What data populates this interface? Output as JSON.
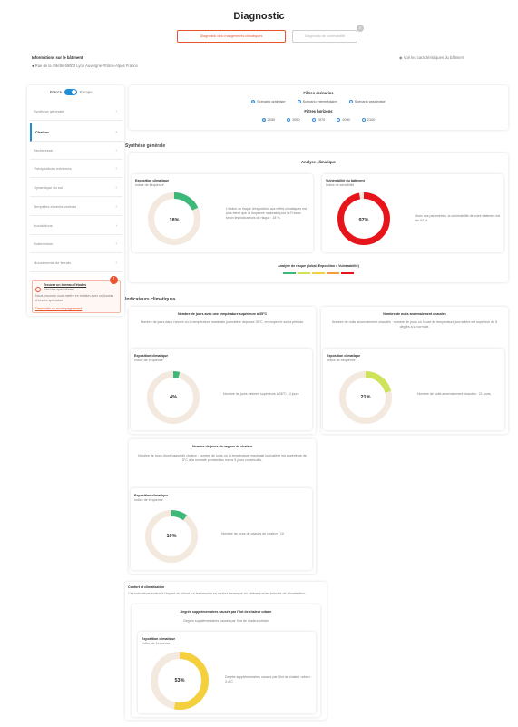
{
  "header": {
    "title": "Diagnostic",
    "step1": "Diagnostic des changements climatiques",
    "step2": "Diagnostic de vulnérabilité",
    "step2_badge": "2"
  },
  "building": {
    "info_label": "Informations sur le bâtiment",
    "address": "Rue de la Villette 69003 Lyon Auvergne-Rhône-Alpes France",
    "climate_link": "Voir les caractéristiques du bâtiment"
  },
  "sidebar": {
    "toggle_left": "France",
    "toggle_right": "Europe",
    "items": [
      {
        "label": "Synthèse générale"
      },
      {
        "label": "Chaleur"
      },
      {
        "label": "Sécheresse"
      },
      {
        "label": "Précipitations extrêmes"
      },
      {
        "label": "Dynamique du sol"
      },
      {
        "label": "Tempêtes et vents violents"
      },
      {
        "label": "Inondations"
      },
      {
        "label": "Submersion"
      },
      {
        "label": "Mouvements de terrain"
      }
    ],
    "promo": {
      "title": "Trouver un bureau d'études",
      "subtitle": "d'études spécialisées",
      "text": "Nous pouvons vous mettre en relation avec un bureau d'études spécialisé",
      "link": "Demander un accompagnement"
    }
  },
  "filters": {
    "scenarios_title": "Filtres scénarios",
    "scenarios": [
      "Scénario optimiste",
      "Scénario intermédiaire",
      "Scénario pessimiste"
    ],
    "horizons_title": "Filtres horizons",
    "horizons": [
      "2030",
      "2050",
      "2070",
      "2090",
      "2100"
    ]
  },
  "synthese": {
    "section_title": "Synthèse générale",
    "analysis_title": "Analyse climatique",
    "exposition": {
      "title": "Exposition climatique",
      "subtitle": "Indice de fréquence",
      "value": "18%",
      "fraction": 0.18,
      "description": "L'indice de risque d'exposition aux effets climatiques est plus élevé que la moyenne nationale pour la France, selon les indicateurs de risque : 18 %."
    },
    "vulnerabilite": {
      "title": "Vulnérabilité du bâtiment",
      "subtitle": "Indice de sensibilité",
      "value": "97%",
      "fraction": 0.97,
      "description": "Avec vos paramètres, la vulnérabilité de votre bâtiment est de 97 %."
    },
    "risk_legend": "Analyse de risque global (Exposition x Vulnérabilité)"
  },
  "indicateurs": {
    "section_title": "Indicateurs climatiques",
    "cards": [
      {
        "title": "Nombre de jours avec une température supérieure à 35°C",
        "desc": "Nombre de jours dans l'année où la température maximale journalière dépasse 35°C, en moyenne sur la période.",
        "exp_title": "Exposition climatique",
        "exp_sub": "Indice de fréquence",
        "value": "4%",
        "fraction": 0.04,
        "side": "Nombre de jours estimés supérieurs à 35°C : 4 jours"
      },
      {
        "title": "Nombre de nuits anormalement chaudes",
        "desc": "Nombre de nuits anormalement chaudes : nombre de jours où l'écart de température journalière est supérieur de 5 degrés à la normale.",
        "exp_title": "Exposition climatique",
        "exp_sub": "Indice de fréquence",
        "value": "21%",
        "fraction": 0.21,
        "side": "Nombre de nuits anormalement chaudes : 21 jours"
      },
      {
        "title": "Nombre de jours de vagues de chaleur",
        "desc": "Nombre de jours d'une vague de chaleur : nombre de jours où la température maximale journalière est supérieure de 5°C à la normale pendant au moins 5 jours consécutifs.",
        "exp_title": "Exposition climatique",
        "exp_sub": "Indice de fréquence",
        "value": "10%",
        "fraction": 0.1,
        "side": "Nombre de jours de vagues de chaleur : 10"
      }
    ]
  },
  "confort": {
    "section_title": "Confort et climatisation",
    "section_desc": "Ces indicateurs évaluent l'impact du climat sur les besoins en confort thermique du bâtiment et les besoins de climatisation.",
    "card_title": "Degrés supplémentaires causés par l'îlot de chaleur urbain",
    "card_desc": "Degrés supplémentaires causés par l'îlot de chaleur urbain",
    "exp_title": "Exposition climatique",
    "exp_sub": "Indice de fréquence",
    "value": "53%",
    "fraction": 0.53,
    "side": "Degrés supplémentaires causés par l'îlot de chaleur urbain : 3.4°C"
  },
  "colors": {
    "accent": "#e8552d",
    "green": "#3cb878",
    "red": "#e8141b",
    "lime": "#cfe35a",
    "yellow": "#f4d03f",
    "track": "#f3e9df",
    "blue": "#1f8ed8"
  }
}
